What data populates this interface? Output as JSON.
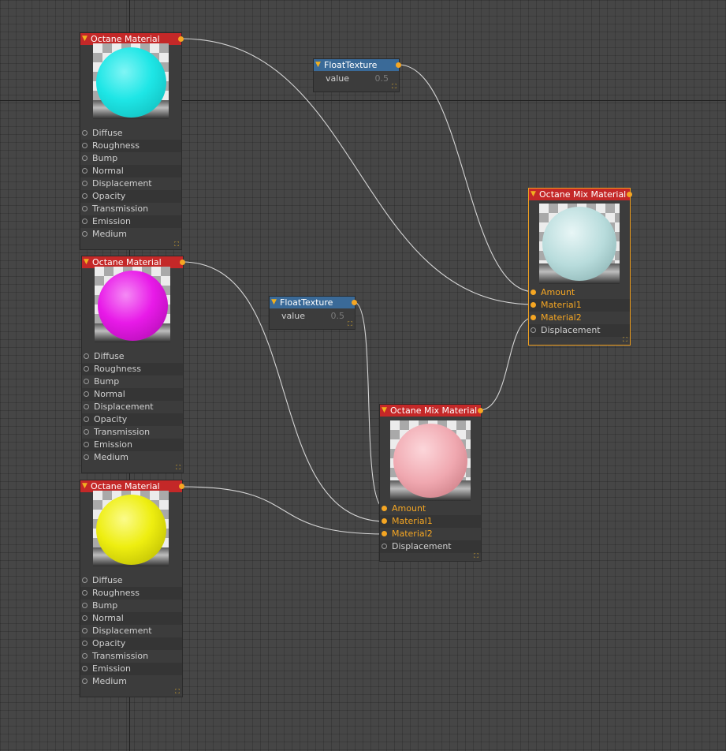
{
  "material_nodes": [
    {
      "title": "Octane Material",
      "sphere_color": "#1ee6e6",
      "ports": [
        "Diffuse",
        "Roughness",
        "Bump",
        "Normal",
        "Displacement",
        "Opacity",
        "Transmission",
        "Emission",
        "Medium"
      ]
    },
    {
      "title": "Octane Material",
      "sphere_color": "#e81ae8",
      "ports": [
        "Diffuse",
        "Roughness",
        "Bump",
        "Normal",
        "Displacement",
        "Opacity",
        "Transmission",
        "Emission",
        "Medium"
      ]
    },
    {
      "title": "Octane Material",
      "sphere_color": "#eeee10",
      "ports": [
        "Diffuse",
        "Roughness",
        "Bump",
        "Normal",
        "Displacement",
        "Opacity",
        "Transmission",
        "Emission",
        "Medium"
      ]
    }
  ],
  "float_nodes": [
    {
      "title": "FloatTexture",
      "param_label": "value",
      "param_value": "0.5"
    },
    {
      "title": "FloatTexture",
      "param_label": "value",
      "param_value": "0.5"
    }
  ],
  "mix_nodes": [
    {
      "title": "Octane Mix Material",
      "sphere_color": "#b8dcdc",
      "ports": [
        "Amount",
        "Material1",
        "Material2",
        "Displacement"
      ],
      "selected": true
    },
    {
      "title": "Octane Mix Material",
      "sphere_color": "#f0a8b0",
      "ports": [
        "Amount",
        "Material1",
        "Material2",
        "Displacement"
      ],
      "selected": false
    }
  ],
  "colors": {
    "header_material": "#c42828",
    "header_texture": "#3a6a98",
    "port_linked": "#f5a623",
    "selection": "#f0a020"
  }
}
